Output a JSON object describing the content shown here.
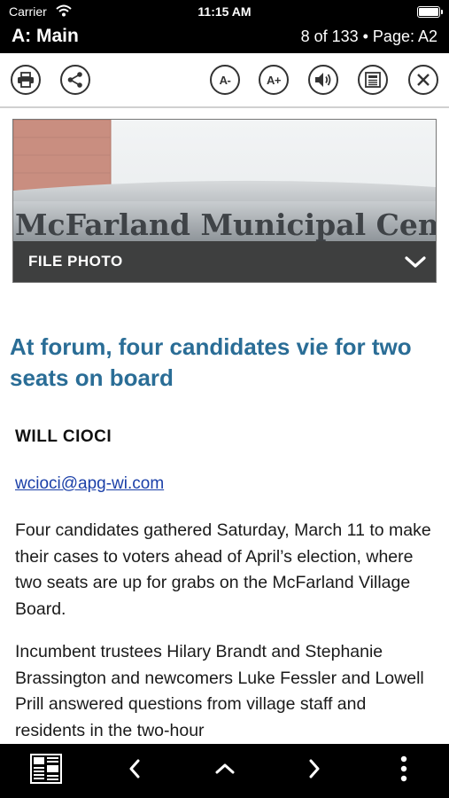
{
  "status_bar": {
    "carrier": "Carrier",
    "time": "11:15 AM",
    "battery_level": 1.0
  },
  "title_bar": {
    "section": "A: Main",
    "page_indicator": "8 of 133 • Page: A2"
  },
  "toolbar": {
    "print_icon": "printer-icon",
    "share_icon": "share-icon",
    "font_decrease_label": "A-",
    "font_increase_label": "A+",
    "audio_icon": "speaker-icon",
    "page_view_icon": "newspaper-page-icon",
    "close_icon": "close-icon"
  },
  "photo": {
    "sign_text": "McFarland Municipal Cen",
    "caption": "FILE PHOTO",
    "toggle_icon": "chevron-down-icon"
  },
  "article": {
    "headline": "At forum, four candidates vie for two seats on board",
    "byline": "WILL CIOCI",
    "email": "wcioci@apg-wi.com",
    "paragraphs": [
      "Four candidates gathered Saturday, March 11 to make their cases to voters ahead of April’s election, where two seats are up for grabs on the McFarland Village Board.",
      "Incumbent trustees Hilary Brandt and Stephanie Brassington and newcomers Luke Fessler and Lowell Prill answered questions from village staff and residents in the two-hour"
    ]
  },
  "bottom_bar": {
    "icons": [
      "newspaper-icon",
      "chevron-left-icon",
      "chevron-up-icon",
      "chevron-right-icon",
      "more-vertical-icon"
    ]
  },
  "colors": {
    "headline": "#2a6d96",
    "link": "#1a3fa8",
    "bars": "#000000"
  }
}
